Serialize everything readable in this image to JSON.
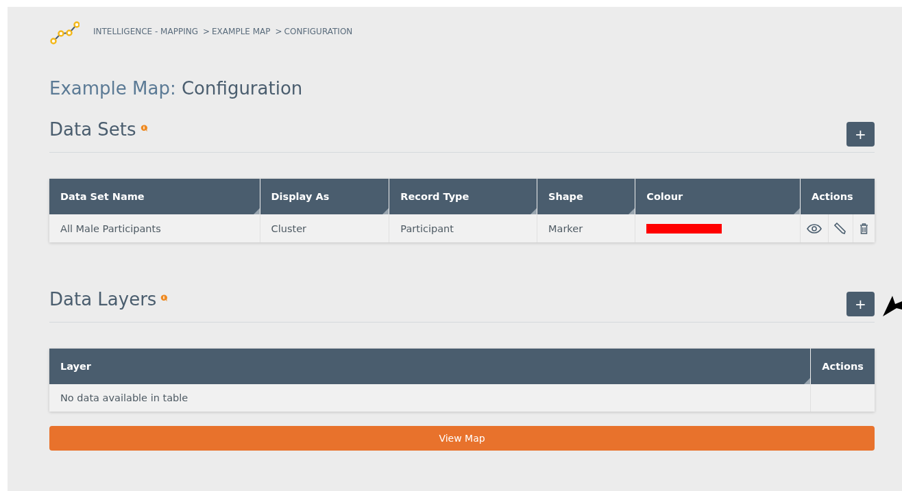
{
  "breadcrumb": [
    "INTELLIGENCE - MAPPING",
    "EXAMPLE MAP",
    "CONFIGURATION"
  ],
  "breadcrumb_separator": ">",
  "page_title": {
    "prefix": "Example Map:",
    "name": "Configuration"
  },
  "data_sets": {
    "title": "Data Sets",
    "add_button": "+",
    "columns": [
      "Data Set Name",
      "Display As",
      "Record Type",
      "Shape",
      "Colour",
      "Actions"
    ],
    "rows": [
      {
        "name": "All Male Participants",
        "display_as": "Cluster",
        "record_type": "Participant",
        "shape": "Marker",
        "color": "#ff0000"
      }
    ]
  },
  "data_layers": {
    "title": "Data Layers",
    "add_button": "+",
    "columns": [
      "Layer",
      "Actions"
    ],
    "empty_message": "No data available in table"
  },
  "view_map_button": "View Map"
}
